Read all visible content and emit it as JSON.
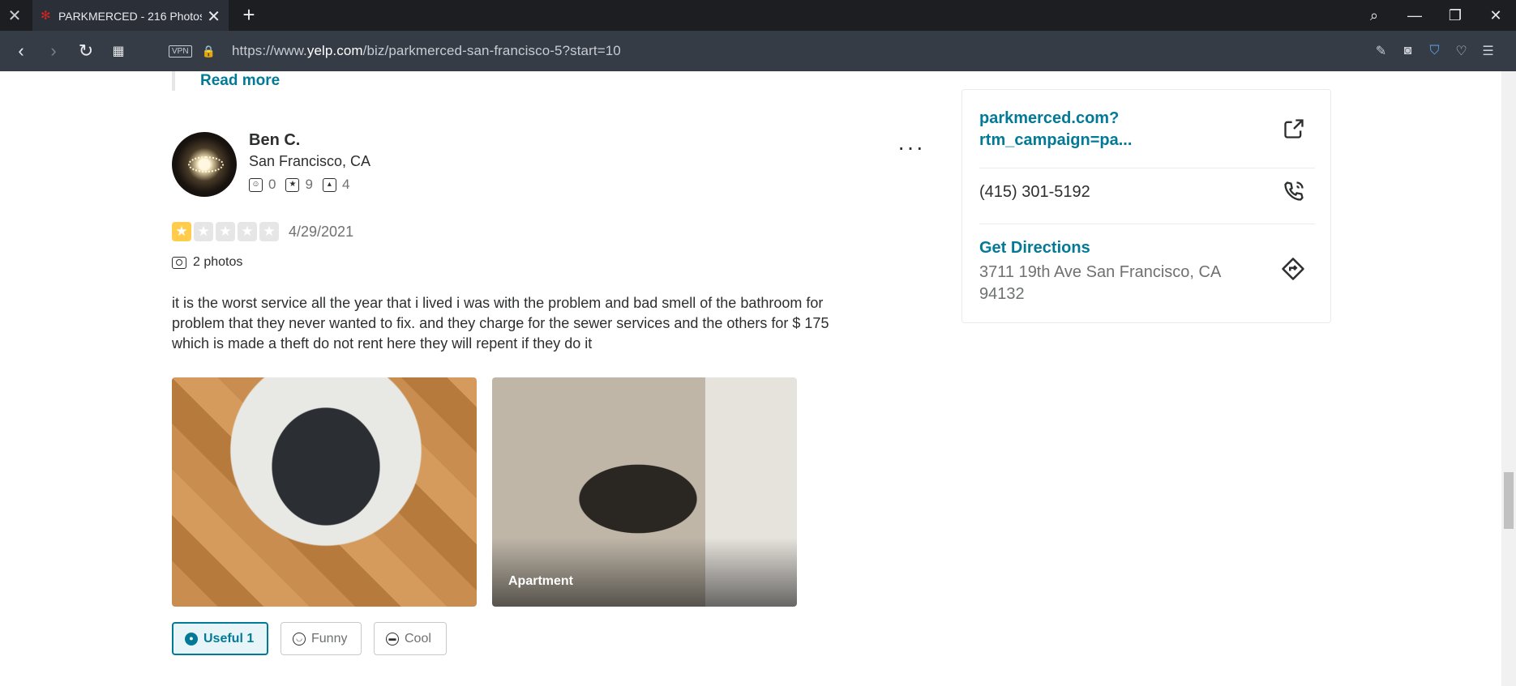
{
  "browser": {
    "tab_title": "PARKMERCED - 216 Photos",
    "url_prefix": "https://www.",
    "url_domain": "yelp.com",
    "url_path": "/biz/parkmerced-san-francisco-5?start=10",
    "vpn_label": "VPN"
  },
  "review": {
    "read_more": "Read more",
    "user_name": "Ben C.",
    "user_location": "San Francisco, CA",
    "friends_count": "0",
    "reviews_count": "9",
    "photos_count": "4",
    "rating": 1,
    "date": "4/29/2021",
    "photos_label": "2 photos",
    "text": "it is the worst service all the year that i lived i was with the problem and bad smell of the bathroom for problem that they never wanted to fix.  and they charge for the sewer services and the others for $ 175 which is made a theft do not rent here they will repent if they do it",
    "photo2_caption": "Apartment",
    "useful_label": "Useful 1",
    "funny_label": "Funny",
    "cool_label": "Cool"
  },
  "sidebar": {
    "website_line1": "parkmerced.com?",
    "website_line2": "rtm_campaign=pa...",
    "phone": "(415) 301-5192",
    "directions_label": "Get Directions",
    "address": "3711 19th Ave San Francisco, CA 94132"
  },
  "colors": {
    "link": "#027a97",
    "star_filled": "#ffcc4b",
    "yelp_red": "#d32323"
  }
}
